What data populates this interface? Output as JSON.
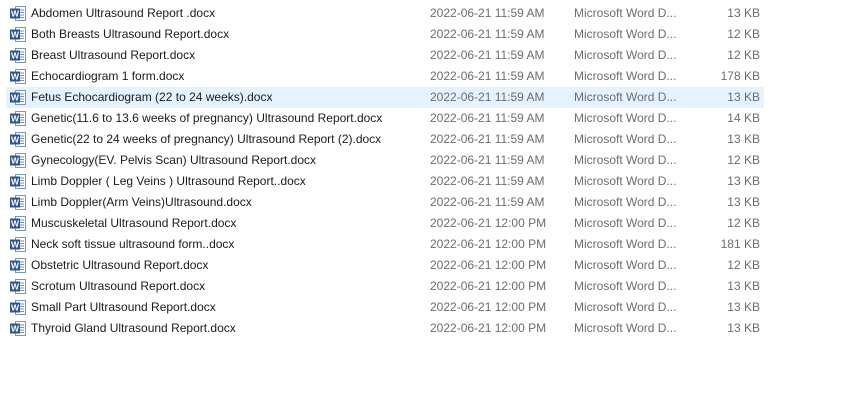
{
  "icons": {
    "file_icon": "word-document-icon",
    "word_blue": "#2b5797",
    "word_letter": "W"
  },
  "selected_index": 4,
  "files": [
    {
      "name": "Abdomen Ultrasound Report .docx",
      "date": "2022-06-21 11:59 AM",
      "type": "Microsoft Word D...",
      "size": "13 KB"
    },
    {
      "name": "Both Breasts Ultrasound Report.docx",
      "date": "2022-06-21 11:59 AM",
      "type": "Microsoft Word D...",
      "size": "12 KB"
    },
    {
      "name": "Breast Ultrasound Report.docx",
      "date": "2022-06-21 11:59 AM",
      "type": "Microsoft Word D...",
      "size": "12 KB"
    },
    {
      "name": "Echocardiogram 1 form.docx",
      "date": "2022-06-21 11:59 AM",
      "type": "Microsoft Word D...",
      "size": "178 KB"
    },
    {
      "name": "Fetus Echocardiogram (22 to 24 weeks).docx",
      "date": "2022-06-21 11:59 AM",
      "type": "Microsoft Word D...",
      "size": "13 KB"
    },
    {
      "name": "Genetic(11.6 to 13.6 weeks of pregnancy) Ultrasound Report.docx",
      "date": "2022-06-21 11:59 AM",
      "type": "Microsoft Word D...",
      "size": "14 KB"
    },
    {
      "name": "Genetic(22  to 24 weeks of pregnancy) Ultrasound Report (2).docx",
      "date": "2022-06-21 11:59 AM",
      "type": "Microsoft Word D...",
      "size": "13 KB"
    },
    {
      "name": "Gynecology(EV. Pelvis Scan) Ultrasound Report.docx",
      "date": "2022-06-21 11:59 AM",
      "type": "Microsoft Word D...",
      "size": "12 KB"
    },
    {
      "name": "Limb Doppler ( Leg  Veins ) Ultrasound Report..docx",
      "date": "2022-06-21 11:59 AM",
      "type": "Microsoft Word D...",
      "size": "13 KB"
    },
    {
      "name": "Limb Doppler(Arm Veins)Ultrasound.docx",
      "date": "2022-06-21 11:59 AM",
      "type": "Microsoft Word D...",
      "size": "13 KB"
    },
    {
      "name": "Muscuskeletal Ultrasound Report.docx",
      "date": "2022-06-21 12:00 PM",
      "type": "Microsoft Word D...",
      "size": "12 KB"
    },
    {
      "name": "Neck  soft tissue ultrasound form..docx",
      "date": "2022-06-21 12:00 PM",
      "type": "Microsoft Word D...",
      "size": "181 KB"
    },
    {
      "name": "Obstetric Ultrasound Report.docx",
      "date": "2022-06-21 12:00 PM",
      "type": "Microsoft Word D...",
      "size": "12 KB"
    },
    {
      "name": "Scrotum Ultrasound Report.docx",
      "date": "2022-06-21 12:00 PM",
      "type": "Microsoft Word D...",
      "size": "13 KB"
    },
    {
      "name": "Small Part Ultrasound Report.docx",
      "date": "2022-06-21 12:00 PM",
      "type": "Microsoft Word D...",
      "size": "13 KB"
    },
    {
      "name": "Thyroid Gland Ultrasound Report.docx",
      "date": "2022-06-21 12:00 PM",
      "type": "Microsoft Word D...",
      "size": "13 KB"
    }
  ]
}
